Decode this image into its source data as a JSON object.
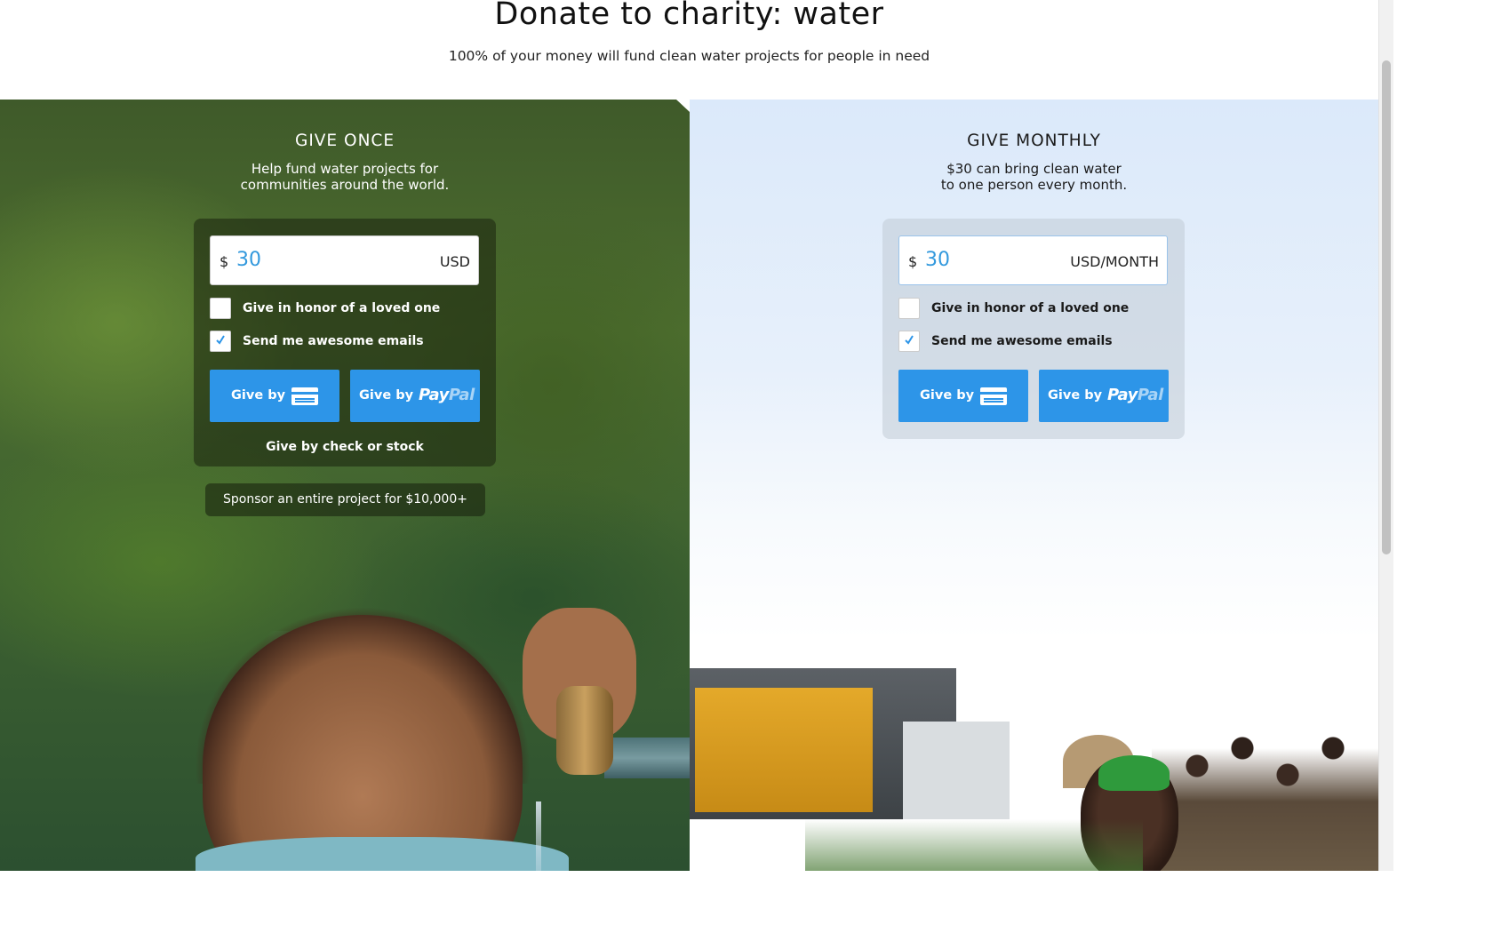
{
  "header": {
    "title": "Donate to charity: water",
    "subtitle": "100% of your money will fund clean water projects for people in need"
  },
  "give_once": {
    "title": "GIVE ONCE",
    "desc_line1": "Help fund water projects for",
    "desc_line2": "communities around the world.",
    "currency_symbol": "$",
    "amount": "30",
    "unit": "USD",
    "honor_label": "Give in honor of a loved one",
    "honor_checked": false,
    "emails_label": "Send me awesome emails",
    "emails_checked": true,
    "card_button_label": "Give by",
    "paypal_button_label": "Give by",
    "paypal_logo_pay": "Pay",
    "paypal_logo_pal": "Pal",
    "check_stock_link": "Give by check or stock",
    "sponsor_button": "Sponsor an entire project for $10,000+"
  },
  "give_monthly": {
    "title": "GIVE MONTHLY",
    "desc_line1": "$30 can bring clean water",
    "desc_line2": "to one person every month.",
    "currency_symbol": "$",
    "amount": "30",
    "unit": "USD/MONTH",
    "honor_label": "Give in honor of a loved one",
    "honor_checked": false,
    "emails_label": "Send me awesome emails",
    "emails_checked": true,
    "card_button_label": "Give by",
    "paypal_button_label": "Give by",
    "paypal_logo_pay": "Pay",
    "paypal_logo_pal": "Pal"
  },
  "colors": {
    "accent": "#2d95e8",
    "amount_text": "#3399dd",
    "check_mark": "#2d95e8"
  },
  "icons": {
    "card": "credit-card-icon",
    "check": "checkmark-icon"
  }
}
